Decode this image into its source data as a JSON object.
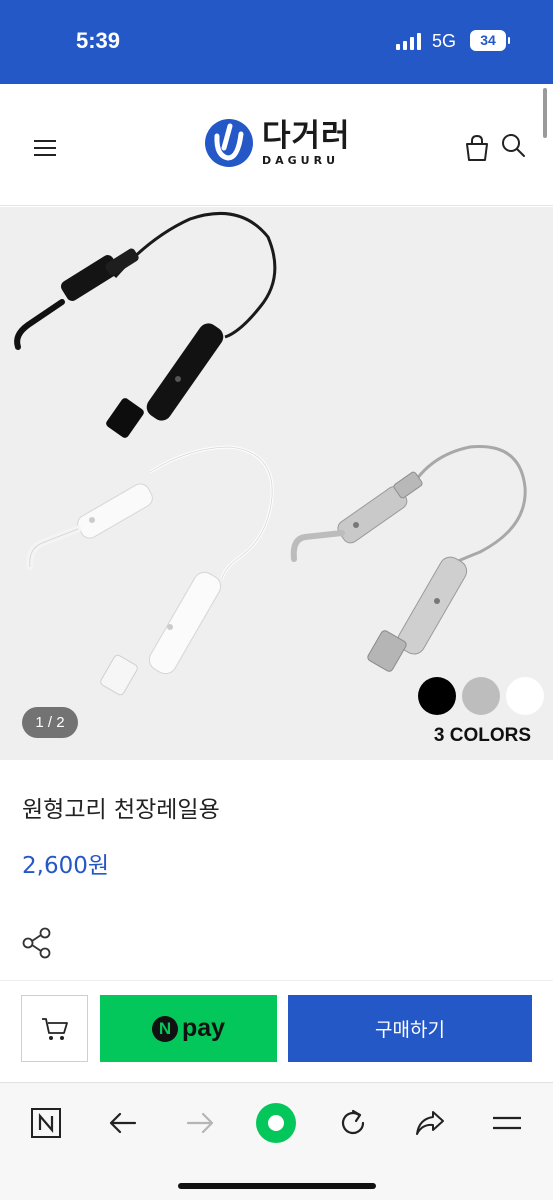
{
  "status_bar": {
    "time": "5:39",
    "network": "5G",
    "battery": "34"
  },
  "header": {
    "logo_text_ko": "다거러",
    "logo_text_en": "DAGURU",
    "brand_color": "#2458c7"
  },
  "gallery": {
    "page_indicator": "1 / 2",
    "colors_label": "3 COLORS",
    "swatch_colors": [
      "#000000",
      "#bdbdbd",
      "#ffffff"
    ]
  },
  "product": {
    "name": "원형고리 천장레일용",
    "price": "2,600원"
  },
  "buy_bar": {
    "npay_label": "pay",
    "npay_badge": "N",
    "buy_label": "구매하기"
  },
  "browser_bar": {
    "icons": [
      "naver-n-icon",
      "back-icon",
      "forward-icon",
      "home-dot-icon",
      "reload-icon",
      "share-arrow-icon",
      "menu-icon"
    ]
  }
}
